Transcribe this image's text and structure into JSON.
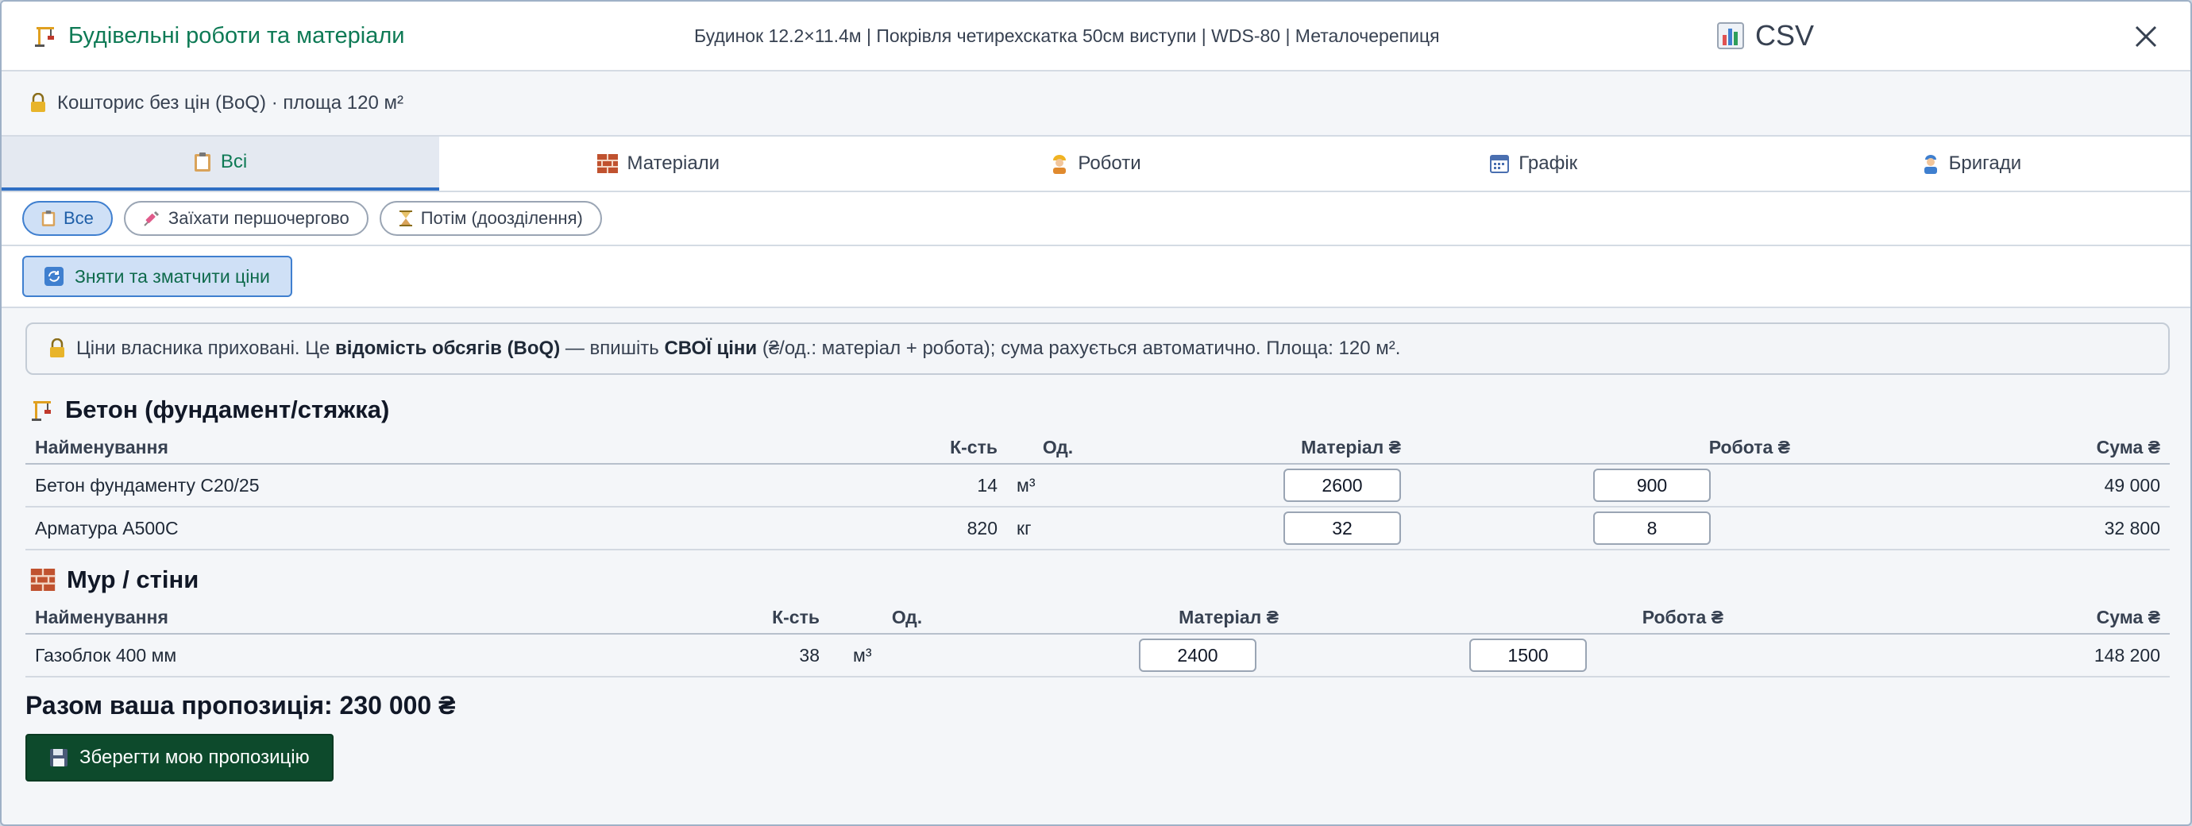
{
  "header": {
    "title": "Будівельні роботи та матеріали",
    "project_summary": "Будинок 12.2×11.4м | Покрівля четирехскатка 50см виступи | WDS-80 | Металочерепиця",
    "csv_label": "CSV"
  },
  "subtitle": "Кошторис без цін (BoQ) · площа 120 м²",
  "tabs": [
    {
      "label": "Всі",
      "icon": "clipboard-icon"
    },
    {
      "label": "Матеріали",
      "icon": "bricks-icon"
    },
    {
      "label": "Роботи",
      "icon": "worker-icon"
    },
    {
      "label": "Графік",
      "icon": "calendar-icon"
    },
    {
      "label": "Бригади",
      "icon": "team-icon"
    }
  ],
  "filters": [
    {
      "label": "Все",
      "active": true
    },
    {
      "label": "Заїхати першочергово",
      "active": false
    },
    {
      "label": "Потім (доозділення)",
      "active": false
    }
  ],
  "refresh_button": "Зняти та зматчити ціни",
  "notice": {
    "part1": "Ціни власника приховані. Це ",
    "bold1": "відомість обсягів (BoQ)",
    "part2": " — впишіть ",
    "bold2": "СВОЇ ціни",
    "part3": " (₴/од.: матеріал + робота); сума рахується автоматично. Площа: 120 м²."
  },
  "columns": {
    "name": "Найменування",
    "qty": "К-сть",
    "unit": "Од.",
    "material": "Матеріал ₴",
    "labor": "Робота ₴",
    "sum": "Сума ₴"
  },
  "sections": [
    {
      "title": "Бетон (фундамент/стяжка)",
      "rows": [
        {
          "name": "Бетон фундаменту C20/25",
          "qty": "14",
          "unit": "м³",
          "material": "2600",
          "labor": "900",
          "sum": "49 000"
        },
        {
          "name": "Арматура A500C",
          "qty": "820",
          "unit": "кг",
          "material": "32",
          "labor": "8",
          "sum": "32 800"
        }
      ]
    },
    {
      "title": "Мур / стіни",
      "rows": [
        {
          "name": "Газоблок 400 мм",
          "qty": "38",
          "unit": "м³",
          "material": "2400",
          "labor": "1500",
          "sum": "148 200"
        }
      ]
    }
  ],
  "total_label": "Разом ваша пропозиція: 230 000 ₴",
  "save_button": "Зберегти мою пропозицію"
}
